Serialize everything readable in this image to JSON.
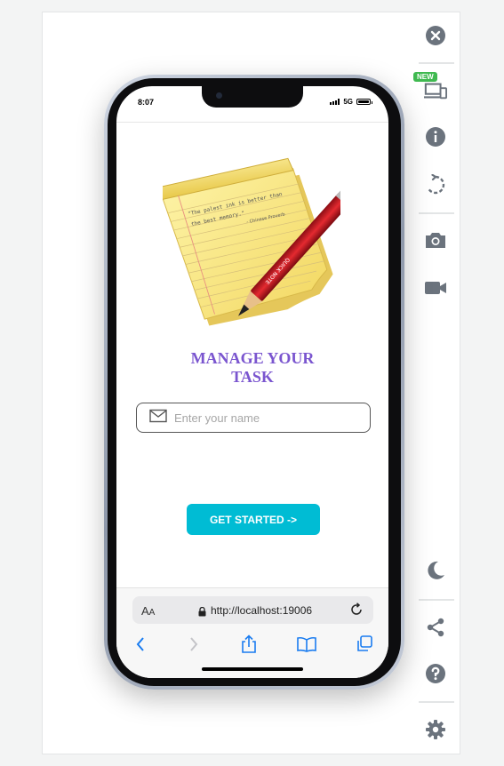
{
  "toolbar": {
    "new_badge": "NEW",
    "icons": [
      "close-icon",
      "devices-icon",
      "info-icon",
      "rotate-icon",
      "camera-icon",
      "video-icon",
      "dark-mode-icon",
      "share-icon",
      "help-icon",
      "settings-icon"
    ]
  },
  "status_bar": {
    "time": "8:07",
    "network": "5G"
  },
  "app": {
    "title_line1": "MANAGE YOUR",
    "title_line2": "TASK",
    "name_placeholder": "Enter your name",
    "name_value": "",
    "start_button": "GET STARTED ->",
    "notepad_quote": "\"The palest ink is better than the best memory.\"",
    "notepad_author": "- Chinese Proverb",
    "pencil_text": "QUICK NOTE"
  },
  "browser": {
    "text_size_label_big": "A",
    "text_size_label_small": "A",
    "url": "http://localhost:19006"
  },
  "colors": {
    "accent_title": "#7a55cf",
    "button": "#00bcd4",
    "toolbar_icon": "#6b737d",
    "browser_blue": "#1a7cf0"
  }
}
